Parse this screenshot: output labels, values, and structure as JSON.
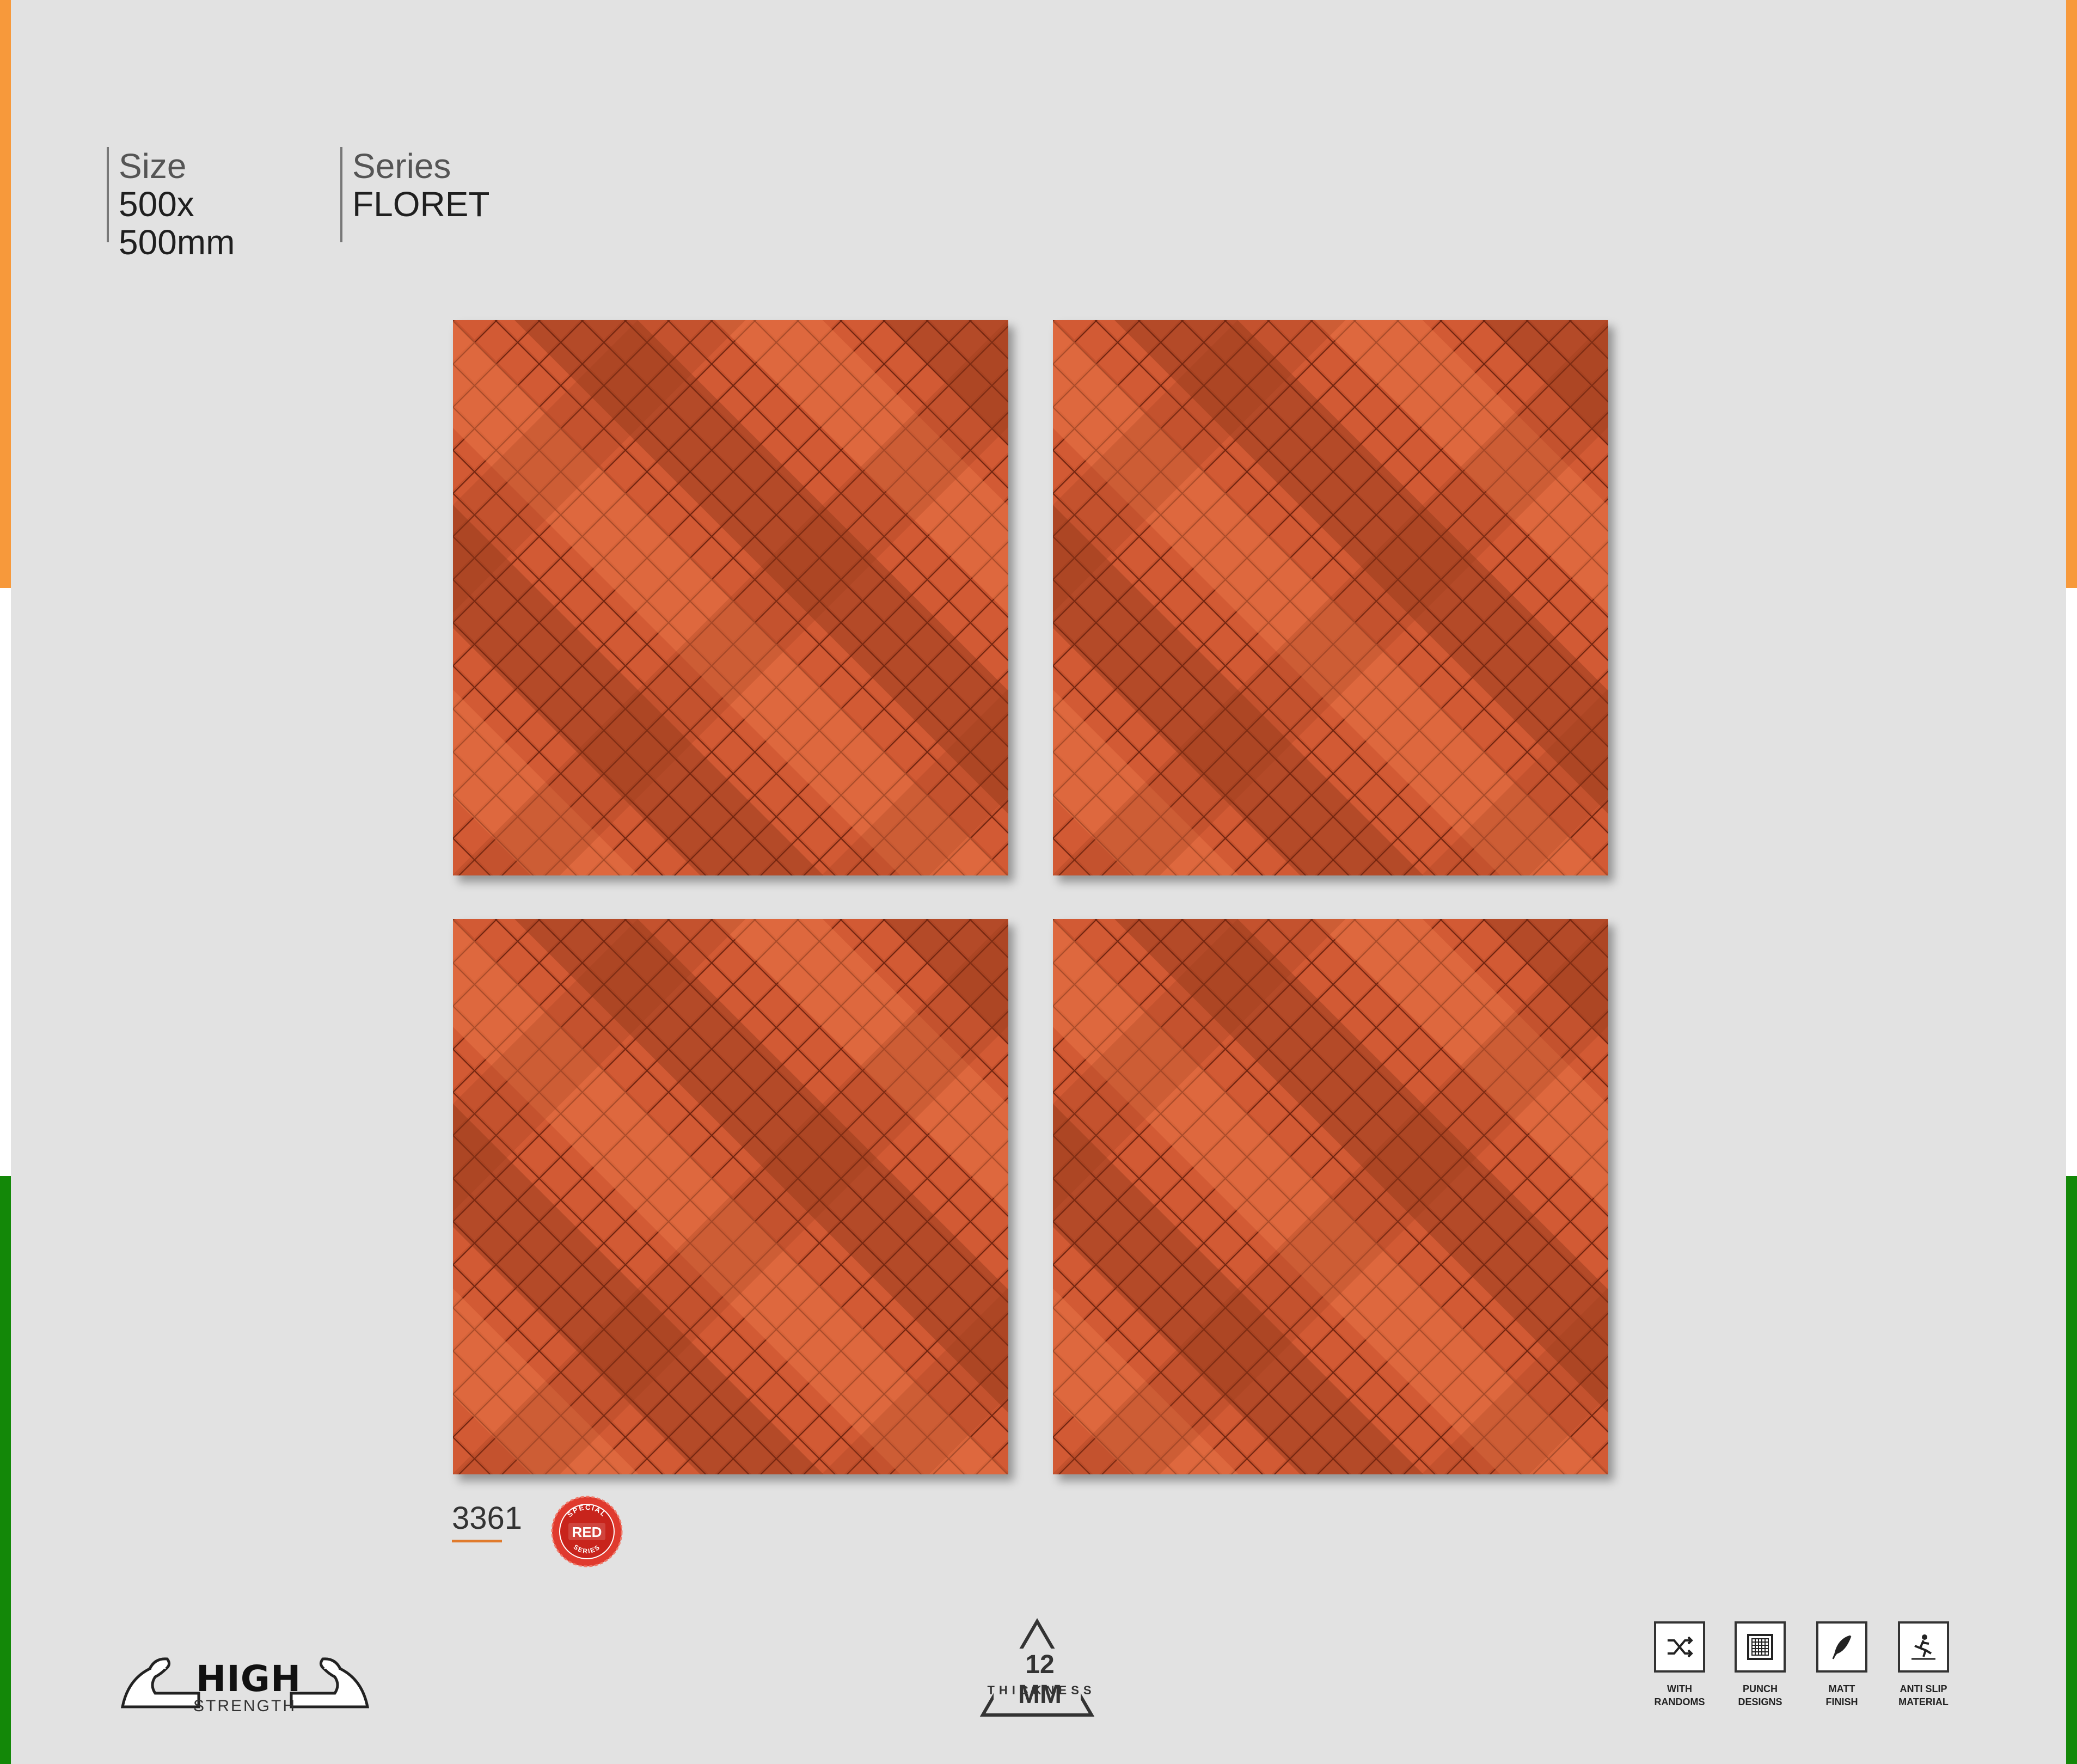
{
  "spec": {
    "size_label": "Size",
    "size_value_1": "500x",
    "size_value_2": "500mm",
    "series_label": "Series",
    "series_value": "FLORET"
  },
  "product": {
    "code": "3361",
    "seal_top": "SPECIAL",
    "seal_center": "RED",
    "seal_bottom": "SERIES"
  },
  "badges": {
    "strength_main": "HIGH",
    "strength_sub": "STRENGTH",
    "thickness_value": "12 MM",
    "thickness_label": "THICKNESS"
  },
  "features": [
    {
      "label": "WITH\nRANDOMS",
      "icon": "shuffle-icon"
    },
    {
      "label": "PUNCH\nDESIGNS",
      "icon": "grid-punch-icon"
    },
    {
      "label": "MATT\nFINISH",
      "icon": "feather-icon"
    },
    {
      "label": "ANTI SLIP\nMATERIAL",
      "icon": "slip-person-icon"
    }
  ],
  "colors": {
    "tile": "#c4502c",
    "tile_light": "#e06a40",
    "tile_dark": "#8a3018",
    "accent_orange": "#f7993b",
    "accent_green": "#138808",
    "seal_red": "#e03a2e"
  }
}
